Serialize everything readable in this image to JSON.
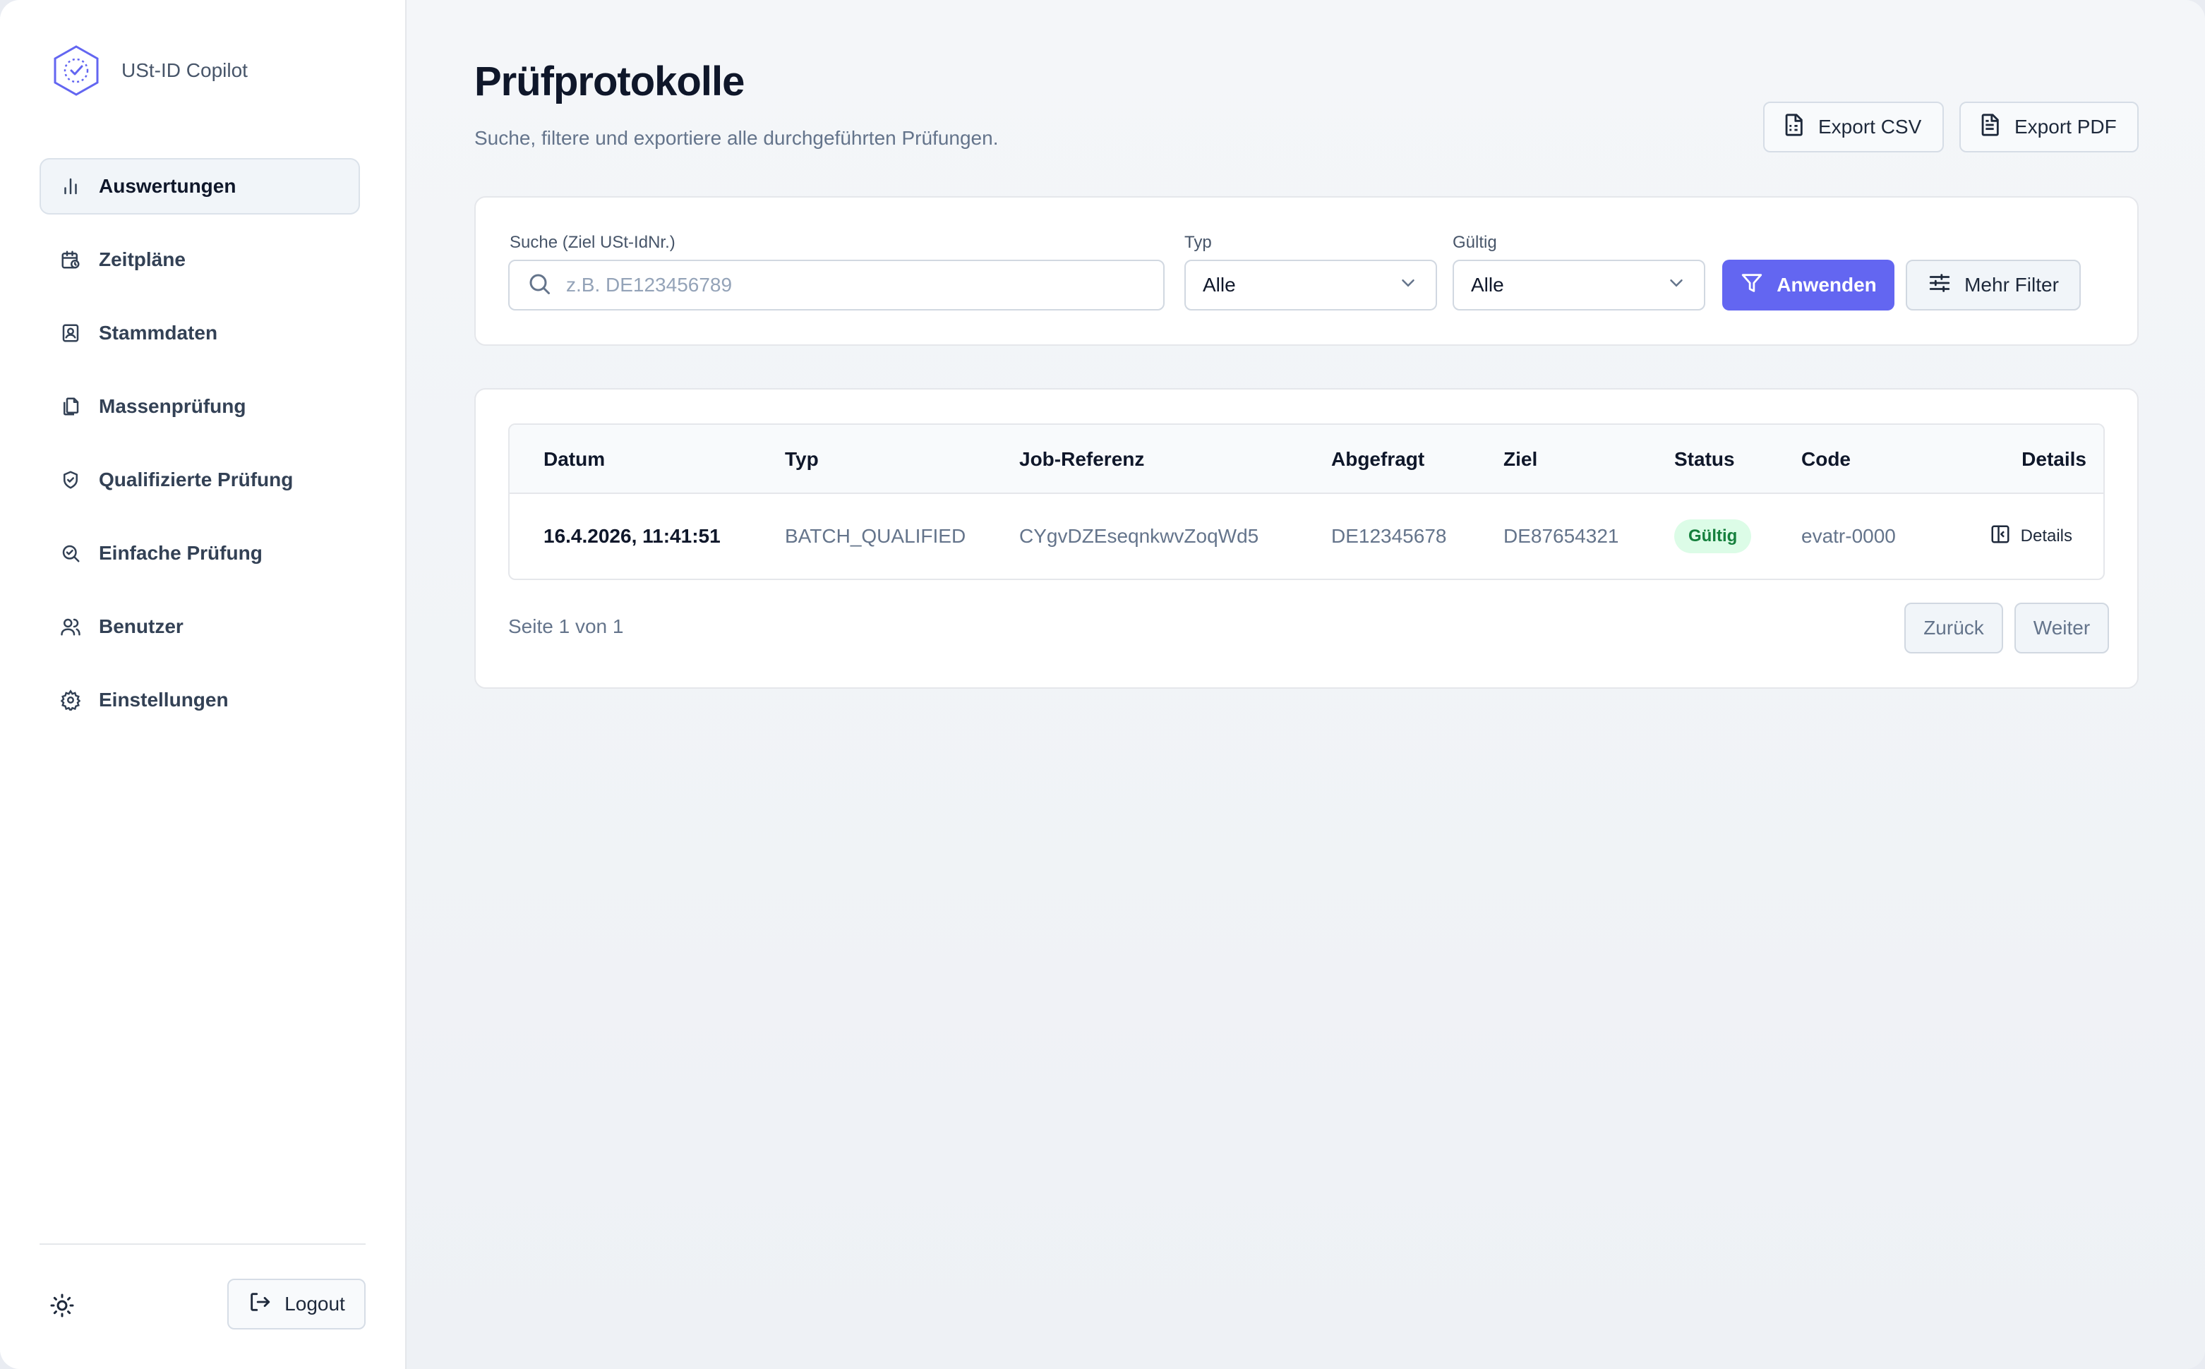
{
  "app": {
    "brand_name": "USt-ID Copilot"
  },
  "sidebar": {
    "items": [
      {
        "label": "Auswertungen",
        "icon": "bar-chart-icon"
      },
      {
        "label": "Zeitpläne",
        "icon": "calendar-clock-icon"
      },
      {
        "label": "Stammdaten",
        "icon": "contact-book-icon"
      },
      {
        "label": "Massenprüfung",
        "icon": "files-icon"
      },
      {
        "label": "Qualifizierte Prüfung",
        "icon": "shield-check-icon"
      },
      {
        "label": "Einfache Prüfung",
        "icon": "search-check-icon"
      },
      {
        "label": "Benutzer",
        "icon": "users-icon"
      },
      {
        "label": "Einstellungen",
        "icon": "gear-icon"
      }
    ],
    "logout_label": "Logout"
  },
  "header": {
    "title": "Prüfprotokolle",
    "subtitle": "Suche, filtere und exportiere alle durchgeführten Prüfungen.",
    "export_csv": "Export CSV",
    "export_pdf": "Export PDF"
  },
  "filters": {
    "search_label": "Suche (Ziel USt-IdNr.)",
    "search_placeholder": "z.B. DE123456789",
    "search_value": "",
    "type_label": "Typ",
    "type_value": "Alle",
    "valid_label": "Gültig",
    "valid_value": "Alle",
    "apply_label": "Anwenden",
    "more_label": "Mehr Filter"
  },
  "table": {
    "columns": [
      "Datum",
      "Typ",
      "Job-Referenz",
      "Abgefragt",
      "Ziel",
      "Status",
      "Code",
      "Details"
    ],
    "rows": [
      {
        "date": "16.4.2026, 11:41:51",
        "type": "BATCH_QUALIFIED",
        "job_ref": "CYgvDZEseqnkwvZoqWd5",
        "queried": "DE12345678",
        "target": "DE87654321",
        "status": "Gültig",
        "code": "evatr-0000",
        "details": "Details"
      }
    ]
  },
  "pagination": {
    "text": "Seite 1 von 1",
    "prev": "Zurück",
    "next": "Weiter"
  },
  "colors": {
    "accent": "#6366f1",
    "status_valid_bg": "#dcfce7",
    "status_valid_text": "#15803d"
  }
}
